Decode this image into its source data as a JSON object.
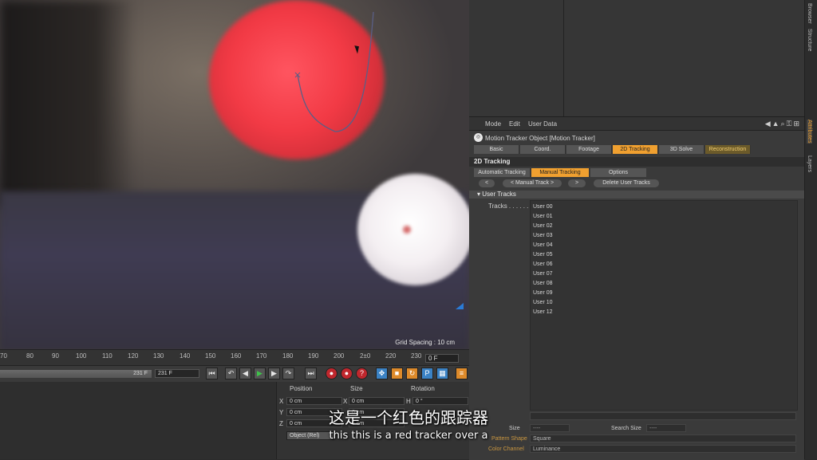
{
  "viewport": {
    "grid_spacing": "Grid Spacing : 10 cm"
  },
  "timeline": {
    "ruler": [
      "70",
      "80",
      "90",
      "100",
      "110",
      "120",
      "130",
      "140",
      "150",
      "160",
      "170",
      "180",
      "190",
      "200",
      "2±0",
      "220",
      "230"
    ],
    "current_frame": "0 F",
    "slider_value": "231 F",
    "end_frame": "231 F"
  },
  "coords": {
    "headers": {
      "position": "Position",
      "size": "Size",
      "rotation": "Rotation"
    },
    "axes": [
      "X",
      "Y",
      "Z"
    ],
    "rot_axis": "H",
    "pos_values": [
      "0 cm",
      "0 cm",
      "0 cm"
    ],
    "size_x": "0 cm",
    "size_yz": [
      "0 cm",
      "0 cm"
    ],
    "rot_h": "0 °",
    "object_mode": "Object (Rel)"
  },
  "side_tabs": [
    "Structure",
    "Browser",
    "Attributes",
    "Layers"
  ],
  "attributes": {
    "menu": [
      "Mode",
      "Edit",
      "User Data"
    ],
    "object_title": "Motion Tracker Object [Motion Tracker]",
    "tabs": [
      "Basic",
      "Coord.",
      "Footage",
      "2D Tracking",
      "3D Solve",
      "Reconstruction"
    ],
    "section": "2D Tracking",
    "subtabs": [
      "Automatic Tracking",
      "Manual Tracking",
      "Options"
    ],
    "buttons": {
      "prev": "<",
      "manual_track": "< Manual Track >",
      "next": ">",
      "delete": "Delete User Tracks"
    },
    "group": "User Tracks",
    "tracks_label": "Tracks . . . . . .",
    "tracks": [
      "User 00",
      "User 01",
      "User 02",
      "User 03",
      "User 04",
      "User 05",
      "User 06",
      "User 07",
      "User 08",
      "User 09",
      "User 10",
      "User 12"
    ],
    "pattern_size_label": "Size",
    "pattern_size_value": "----",
    "search_size_label": "Search Size",
    "search_size_value": "----",
    "pattern_shape_label": "Pattern Shape",
    "pattern_shape_value": "Square",
    "color_channel_label": "Color Channel",
    "color_channel_value": "Luminance"
  },
  "subtitles": {
    "cn": "这是一个红色的跟踪器",
    "en": "this this is a red tracker over a"
  },
  "colors": {
    "accent": "#f0a030",
    "tracker_curve": "#5a5f86",
    "red_ball": "#f23a45"
  }
}
